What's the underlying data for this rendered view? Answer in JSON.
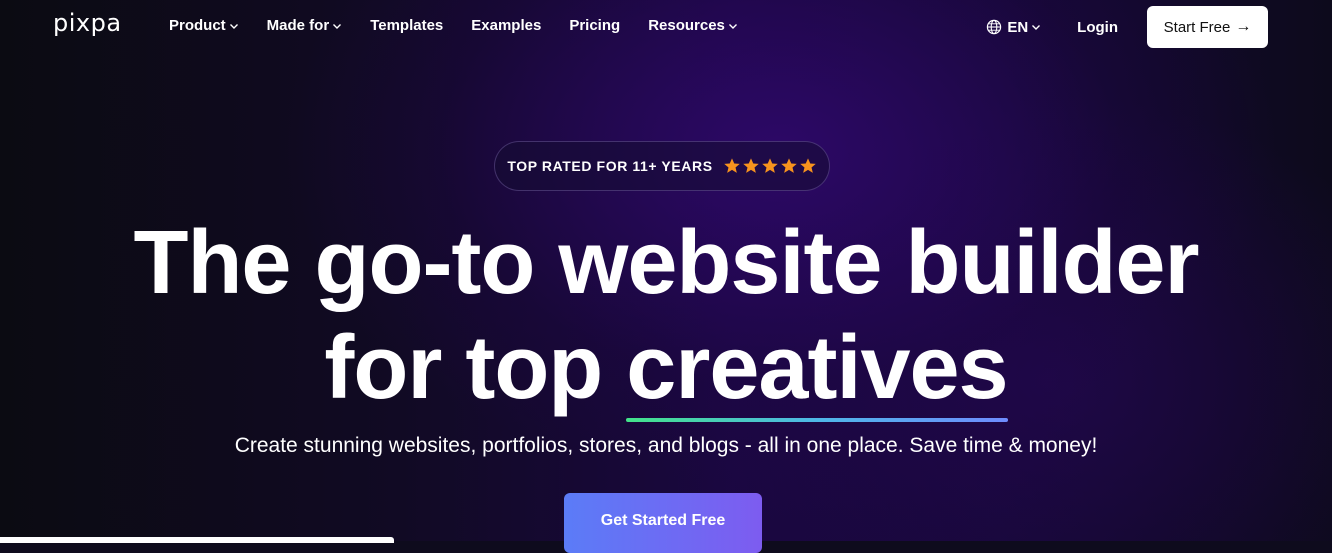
{
  "brand": {
    "logo": "pixpa"
  },
  "nav": {
    "items": [
      {
        "label": "Product",
        "has_dropdown": true
      },
      {
        "label": "Made for",
        "has_dropdown": true
      },
      {
        "label": "Templates",
        "has_dropdown": false
      },
      {
        "label": "Examples",
        "has_dropdown": false
      },
      {
        "label": "Pricing",
        "has_dropdown": false
      },
      {
        "label": "Resources",
        "has_dropdown": true
      }
    ],
    "language": "EN",
    "login": "Login",
    "start_free": "Start Free",
    "start_free_arrow": "→"
  },
  "hero": {
    "badge_text": "TOP RATED FOR 11+ YEARS",
    "badge_stars": 5,
    "headline_line1": "The go-to website builder",
    "headline_line2_prefix": "for top ",
    "headline_line2_highlight": "creatives",
    "subtitle": "Create stunning websites, portfolios, stores, and blogs - all in one place. Save time & money!",
    "cta": "Get Started Free"
  },
  "colors": {
    "star": "#f7931e",
    "cta_start": "#5b7cf7",
    "cta_end": "#7d5cf0",
    "underline_start": "#43e38a",
    "underline_end": "#6f8cff"
  }
}
